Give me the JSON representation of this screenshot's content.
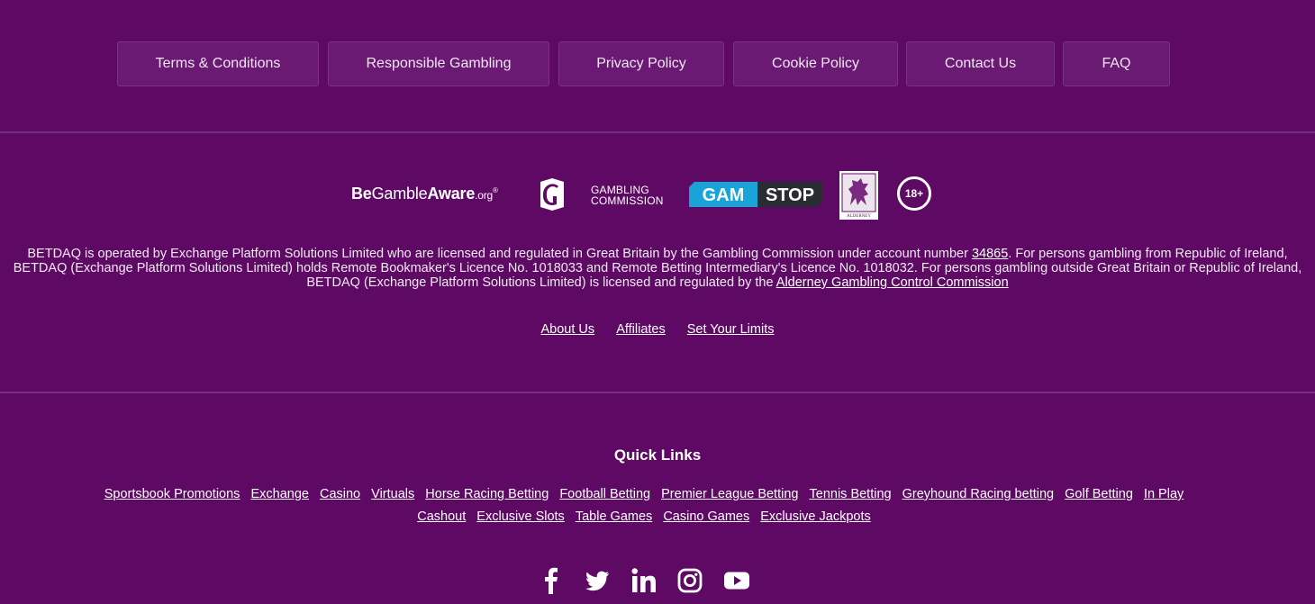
{
  "nav": {
    "buttons": [
      "Terms & Conditions",
      "Responsible Gambling",
      "Privacy Policy",
      "Cookie Policy",
      "Contact Us",
      "FAQ"
    ]
  },
  "logos": {
    "begambleaware": {
      "be": "Be",
      "gamble": "Gamble",
      "aware": "Aware",
      "org": ".org",
      "reg": "®"
    },
    "gambling_commission": {
      "line1": "GAMBLING",
      "line2": "COMMISSION"
    },
    "gamstop": {
      "left": "GAM",
      "right": "STOP"
    },
    "alderney": {
      "caption": "ALDERNEY"
    },
    "age": "18+"
  },
  "legal": {
    "text1": "BETDAQ is operated by Exchange Platform Solutions Limited who are licensed and regulated in Great Britain by the Gambling Commission under account number ",
    "account_link": "34865",
    "text2": ". For persons gambling from Republic of Ireland, BETDAQ (Exchange Platform Solutions Limited) holds Remote Bookmaker's Licence No. 1018033 and Remote Betting Intermediary's Licence No. 1018032. For persons gambling outside Great Britain or Republic of Ireland, BETDAQ (Exchange Platform Solutions Limited) is licensed and regulated by the ",
    "alderney_link": "Alderney Gambling Control Commission"
  },
  "footer_links": [
    "About Us",
    "Affiliates",
    "Set Your Limits"
  ],
  "quick_links": {
    "title": "Quick Links",
    "items": [
      "Sportsbook Promotions",
      "Exchange",
      "Casino",
      "Virtuals",
      "Horse Racing Betting",
      "Football Betting",
      "Premier League Betting",
      "Tennis Betting",
      "Greyhound Racing betting",
      "Golf Betting",
      "In Play",
      "Cashout",
      "Exclusive Slots",
      "Table Games",
      "Casino Games",
      "Exclusive Jackpots"
    ]
  },
  "social": [
    "facebook-icon",
    "twitter-icon",
    "linkedin-icon",
    "instagram-icon",
    "youtube-icon"
  ],
  "colors": {
    "background": "#5e0a64",
    "button_bg": "#6a1a72",
    "gamstop_blue": "#1aa3d9"
  }
}
